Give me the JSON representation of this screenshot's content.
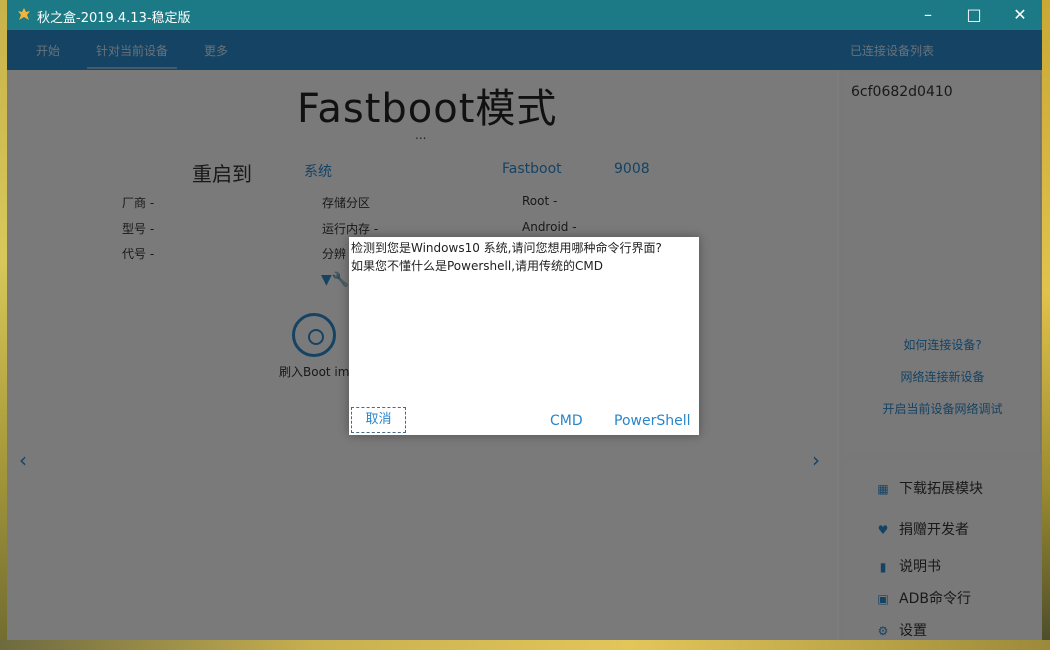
{
  "window": {
    "title": "秋之盒-2019.4.13-稳定版"
  },
  "menu": {
    "items": [
      "开始",
      "针对当前设备",
      "更多"
    ],
    "right": "已连接设备列表"
  },
  "main": {
    "title": "Fastboot模式",
    "dots": "...",
    "reboot_label": "重启到",
    "reboot_options": [
      "系统",
      "",
      "Fastboot",
      "9008"
    ],
    "info": {
      "col1": [
        "厂商 -",
        "型号 -",
        "代号 -"
      ],
      "col2": [
        "存储分区",
        "运行内存 -",
        "分辨"
      ],
      "col3": [
        "Root -",
        "Android -"
      ]
    },
    "flash_boot_label": "刷入Boot img"
  },
  "sidebar": {
    "device_id": "6cf0682d0410",
    "links": [
      "如何连接设备?",
      "网络连接新设备",
      "开启当前设备网络调试"
    ],
    "tools": [
      {
        "icon": "grid-icon",
        "label": "下载拓展模块"
      },
      {
        "icon": "heart-icon",
        "label": "捐赠开发者"
      },
      {
        "icon": "book-icon",
        "label": "说明书"
      },
      {
        "icon": "terminal-icon",
        "label": "ADB命令行"
      },
      {
        "icon": "gear-icon",
        "label": "设置"
      }
    ]
  },
  "dialog": {
    "line1": "检测到您是Windows10 系统,请问您想用哪种命令行界面?",
    "line2": "如果您不懂什么是Powershell,请用传统的CMD",
    "cancel": "取消",
    "cmd": "CMD",
    "powershell": "PowerShell"
  },
  "colors": {
    "titlebar": "#1b7a86",
    "menubar": "#2a86c8",
    "accent": "#2a86c8"
  }
}
